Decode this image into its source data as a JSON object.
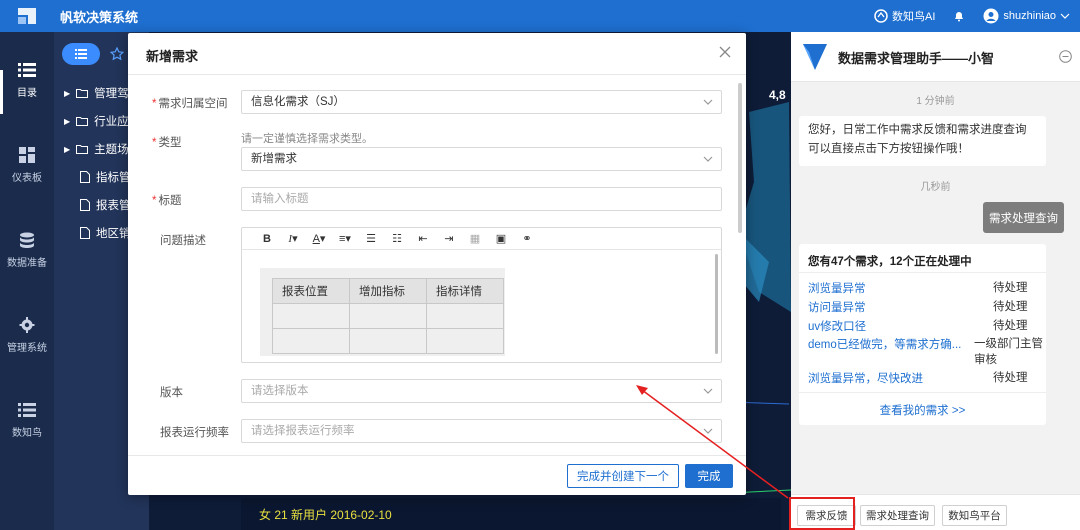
{
  "topbar": {
    "app_title": "帆软决策系统",
    "ai_label": "数知鸟AI",
    "username": "shuzhiniao"
  },
  "leftnav": {
    "items": [
      {
        "label": "目录",
        "icon": "list-icon"
      },
      {
        "label": "仪表板",
        "icon": "dashboard-icon"
      },
      {
        "label": "数据准备",
        "icon": "database-icon"
      },
      {
        "label": "管理系统",
        "icon": "gear-icon"
      },
      {
        "label": "数知鸟",
        "icon": "list-icon"
      }
    ]
  },
  "tree": {
    "items": [
      {
        "label": "管理驾"
      },
      {
        "label": "行业应"
      },
      {
        "label": "主题场"
      },
      {
        "label": "指标管"
      },
      {
        "label": "报表管"
      },
      {
        "label": "地区销"
      }
    ]
  },
  "dashboard": {
    "footer_text": "女 21 新用户 2016-02-10",
    "stat_number": "4,8"
  },
  "modal": {
    "title": "新增需求",
    "fields": {
      "space_label": "需求归属空间",
      "space_value": "信息化需求（SJ）",
      "type_label": "类型",
      "type_hint": "请一定谨慎选择需求类型。",
      "type_value": "新增需求",
      "title_label": "标题",
      "title_placeholder": "请输入标题",
      "desc_label": "问题描述",
      "version_label": "版本",
      "version_placeholder": "请选择版本",
      "freq_label": "报表运行频率",
      "freq_placeholder": "请选择报表运行频率"
    },
    "table": {
      "headers": [
        "报表位置",
        "增加指标",
        "指标详情"
      ]
    },
    "buttons": {
      "create_next": "完成并创建下一个",
      "done": "完成"
    }
  },
  "chat": {
    "title": "数据需求管理助手——小智",
    "time1": "1 分钟前",
    "greeting": "您好，日常工作中需求反馈和需求进度查询可以直接点击下方按钮操作哦！",
    "time2": "几秒前",
    "user_msg": "需求处理查询",
    "summary": "您有47个需求，12个正在处理中",
    "requests": [
      {
        "name": "浏览量异常",
        "status": "待处理"
      },
      {
        "name": "访问量异常",
        "status": "待处理"
      },
      {
        "name": "uv修改口径",
        "status": "待处理"
      },
      {
        "name": "demo已经做完，等需求方确...",
        "status": "一级部门主管审核"
      },
      {
        "name": "浏览量异常，尽快改进",
        "status": "待处理"
      }
    ],
    "more": "查看我的需求 >>",
    "quick_buttons": [
      "需求反馈",
      "需求处理查询",
      "数知鸟平台"
    ]
  },
  "colors": {
    "brand": "#1e6fd0",
    "highlight": "#e52020"
  }
}
